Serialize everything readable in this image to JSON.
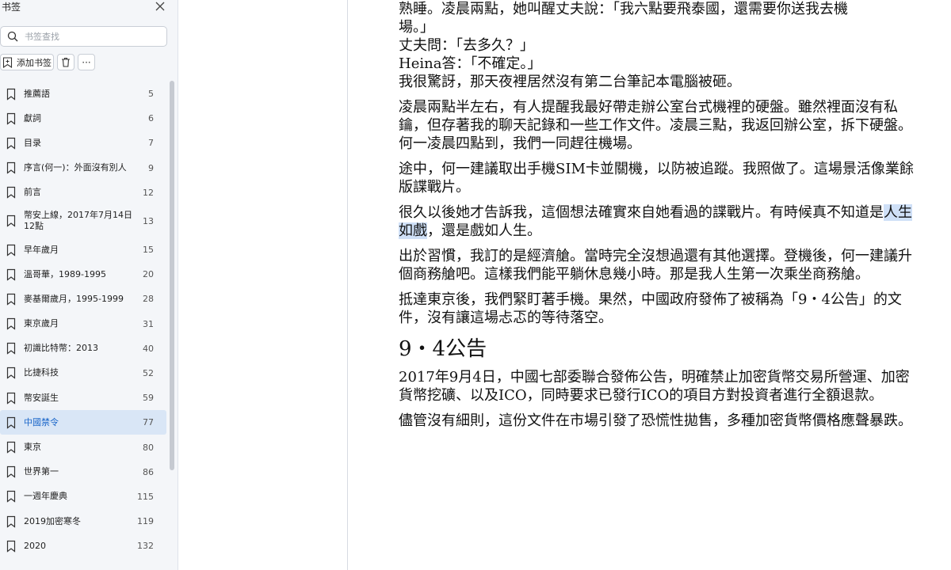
{
  "sidebar": {
    "title": "书签",
    "search_placeholder": "书签查找",
    "add_label": "添加书签",
    "more_label": "···",
    "items": [
      {
        "label": "推薦語",
        "page": "5"
      },
      {
        "label": "獻詞",
        "page": "6"
      },
      {
        "label": "目录",
        "page": "7"
      },
      {
        "label": "序言(何一)：外面沒有別人",
        "page": "9"
      },
      {
        "label": "前言",
        "page": "12"
      },
      {
        "label": "幣安上線，2017年7月14日12點",
        "page": "13"
      },
      {
        "label": "早年歲月",
        "page": "15"
      },
      {
        "label": "溫哥華，1989-1995",
        "page": "20"
      },
      {
        "label": "麥基爾歲月，1995-1999",
        "page": "28"
      },
      {
        "label": "東京歲月",
        "page": "31"
      },
      {
        "label": "初識比特幣：2013",
        "page": "40"
      },
      {
        "label": "比捷科技",
        "page": "52"
      },
      {
        "label": "幣安誕生",
        "page": "59"
      },
      {
        "label": "中國禁令",
        "page": "77"
      },
      {
        "label": "東京",
        "page": "80"
      },
      {
        "label": "世界第一",
        "page": "86"
      },
      {
        "label": "一週年慶典",
        "page": "115"
      },
      {
        "label": "2019加密寒冬",
        "page": "119"
      },
      {
        "label": "2020",
        "page": "132"
      }
    ]
  },
  "content": {
    "p1a": "熟睡。凌晨兩點，她叫醒丈夫說：「我六點要飛泰國，還需要你送我去機",
    "p1b": "場。」",
    "p2": "丈夫問：「去多久？」",
    "p3": "Heina答：「不確定。」",
    "p4": "我很驚訝，那天夜裡居然沒有第二台筆記本電腦被砸。",
    "p5": "凌晨兩點半左右，有人提醒我最好帶走辦公室台式機裡的硬盤。雖然裡面沒有私鑰，但存著我的聊天記錄和一些工作文件。凌晨三點，我返回辦公室，拆下硬盤。何一凌晨四點到，我們一同趕往機場。",
    "p6": "途中，何一建議取出手機SIM卡並關機，以防被追蹤。我照做了。這場景活像業餘版諜戰片。",
    "p7_pre": "很久以後她才告訴我，這個想法確實來自她看過的諜戰片。有時候真不知道是",
    "p7_hl": "人生如戲",
    "p7_post": "，還是戲如人生。",
    "p8": "出於習慣，我訂的是經濟艙。當時完全沒想過還有其他選擇。登機後，何一建議升個商務艙吧。這樣我們能平躺休息幾小時。那是我人生第一次乘坐商務艙。",
    "p9": "抵達東京後，我們緊盯著手機。果然，中國政府發佈了被稱為「9・4公告」的文件，沒有讓這場忐忑的等待落空。",
    "heading": "9・4公告",
    "p10": "2017年9月4日，中國七部委聯合發佈公告，明確禁止加密貨幣交易所營運、加密貨幣挖礦、以及ICO，同時要求已發行ICO的項目方對投資者進行全額退款。",
    "p11": "儘管沒有細則，這份文件在市場引發了恐慌性拋售，多種加密貨幣價格應聲暴跌。"
  }
}
